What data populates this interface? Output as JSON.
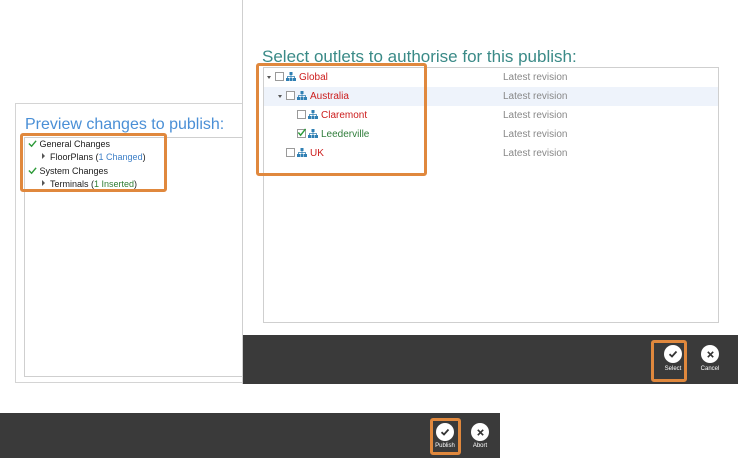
{
  "preview": {
    "title": "Preview changes to publish:",
    "groups": [
      {
        "label": "General Changes",
        "item": "FloorPlans",
        "open": " (",
        "change": "1 Changed",
        "close": ")"
      },
      {
        "label": "System Changes",
        "item": "Terminals",
        "open": " (",
        "change": "1 Inserted",
        "close": ")"
      }
    ],
    "buttons": {
      "publish": "Publish",
      "abort": "Abort"
    }
  },
  "outlets": {
    "title": "Select outlets to authorise for this publish:",
    "rows": [
      {
        "name": "Global",
        "revision": "Latest revision",
        "checked": false
      },
      {
        "name": "Australia",
        "revision": "Latest revision",
        "checked": false
      },
      {
        "name": "Claremont",
        "revision": "Latest revision",
        "checked": false
      },
      {
        "name": "Leederville",
        "revision": "Latest revision",
        "checked": true
      },
      {
        "name": "UK",
        "revision": "Latest revision",
        "checked": false
      }
    ],
    "buttons": {
      "select": "Select",
      "cancel": "Cancel"
    }
  },
  "colors": {
    "accent_teal": "#3a8a87",
    "title_blue": "#4a8fd6",
    "outlet_red": "#cc1c1c",
    "highlight_orange": "#e0883d",
    "bar_dark": "#3a3a3a"
  }
}
